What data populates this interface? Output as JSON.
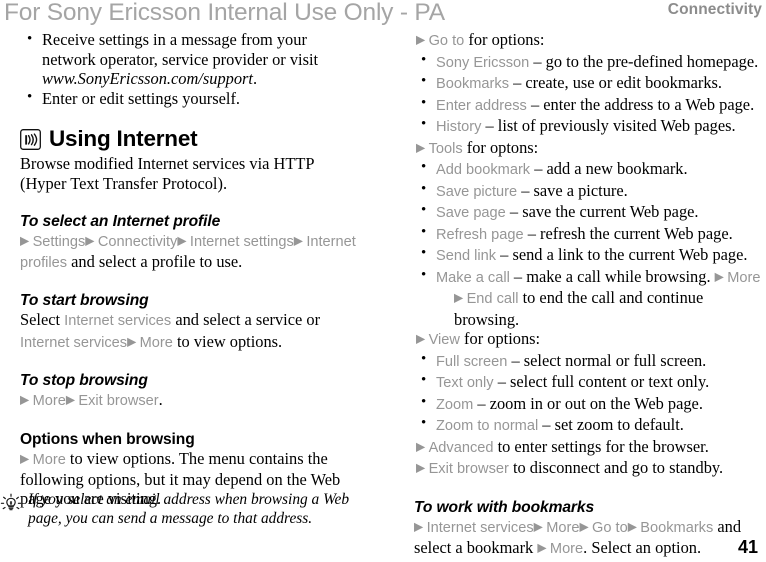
{
  "header": {
    "watermark": "For Sony Ericsson Internal Use Only - PA",
    "chapter": "Connectivity"
  },
  "page_number": "41",
  "left_column": {
    "intro_bullets": [
      {
        "line1": "Receive settings in a message from your",
        "line2": "network operator, service provider or visit",
        "line3_italic": "www.SonyEricsson.com/support",
        "line3_tail": "."
      },
      {
        "line1": "Enter or edit settings yourself."
      }
    ],
    "section": {
      "icon": "wifi-signal-icon",
      "title": "Using Internet",
      "description_line1": "Browse modified Internet services via HTTP",
      "description_line2": "(Hyper Text Transfer Protocol)."
    },
    "procedures": [
      {
        "heading": "To select an Internet profile",
        "heading_style": "italic",
        "parts": [
          {
            "t": "arrow"
          },
          {
            "t": "ui",
            "v": "Settings"
          },
          {
            "t": "arrow"
          },
          {
            "t": "ui",
            "v": "Connectivity"
          },
          {
            "t": "arrow"
          },
          {
            "t": "ui",
            "v": "Internet settings"
          },
          {
            "t": "arrow"
          },
          {
            "t": "ui",
            "v": "Internet profiles"
          },
          {
            "t": "text",
            "v": " and select a profile to use."
          }
        ]
      },
      {
        "heading": "To start browsing",
        "heading_style": "italic",
        "parts": [
          {
            "t": "text",
            "v": "Select "
          },
          {
            "t": "ui",
            "v": "Internet services"
          },
          {
            "t": "text",
            "v": " and select a service or "
          },
          {
            "t": "ui",
            "v": "Internet services"
          },
          {
            "t": "arrow"
          },
          {
            "t": "ui",
            "v": "More"
          },
          {
            "t": "text",
            "v": " to view options."
          }
        ]
      },
      {
        "heading": "To stop browsing",
        "heading_style": "italic",
        "parts": [
          {
            "t": "arrow"
          },
          {
            "t": "ui",
            "v": "More"
          },
          {
            "t": "arrow"
          },
          {
            "t": "ui",
            "v": "Exit browser"
          },
          {
            "t": "text",
            "v": "."
          }
        ]
      },
      {
        "heading": "Options when browsing",
        "heading_style": "upright",
        "parts": [
          {
            "t": "arrow"
          },
          {
            "t": "ui",
            "v": "More"
          },
          {
            "t": "text",
            "v": " to view options. The menu contains the following options, but it may depend on the Web page you are visiting."
          }
        ]
      }
    ],
    "tip": {
      "icon": "lightbulb-tip-icon",
      "text": "If you select an email address when browsing a Web page, you can send a message to that address."
    }
  },
  "right_column": {
    "blocks": [
      {
        "type": "arrow-line",
        "parts": [
          {
            "t": "arrow"
          },
          {
            "t": "ui",
            "v": "Go to"
          },
          {
            "t": "text",
            "v": " for options:"
          }
        ]
      },
      {
        "type": "bullets",
        "items": [
          [
            {
              "t": "ui",
              "v": "Sony Ericsson"
            },
            {
              "t": "text",
              "v": " – go to the pre-defined homepage."
            }
          ],
          [
            {
              "t": "ui",
              "v": "Bookmarks"
            },
            {
              "t": "text",
              "v": " – create, use or edit bookmarks."
            }
          ],
          [
            {
              "t": "ui",
              "v": "Enter address"
            },
            {
              "t": "text",
              "v": " – enter the address to a Web page."
            }
          ],
          [
            {
              "t": "ui",
              "v": "History"
            },
            {
              "t": "text",
              "v": " – list of previously visited Web pages."
            }
          ]
        ]
      },
      {
        "type": "arrow-line",
        "parts": [
          {
            "t": "arrow"
          },
          {
            "t": "ui",
            "v": "Tools"
          },
          {
            "t": "text",
            "v": " for optons:"
          }
        ]
      },
      {
        "type": "bullets",
        "items": [
          [
            {
              "t": "ui",
              "v": "Add bookmark"
            },
            {
              "t": "text",
              "v": " – add a new bookmark."
            }
          ],
          [
            {
              "t": "ui",
              "v": "Save picture"
            },
            {
              "t": "text",
              "v": " – save a picture."
            }
          ],
          [
            {
              "t": "ui",
              "v": "Save page"
            },
            {
              "t": "text",
              "v": " – save the current Web page."
            }
          ],
          [
            {
              "t": "ui",
              "v": "Refresh page"
            },
            {
              "t": "text",
              "v": " – refresh the current Web page."
            }
          ],
          [
            {
              "t": "ui",
              "v": "Send link"
            },
            {
              "t": "text",
              "v": " – send a link to the current Web page."
            }
          ],
          [
            {
              "t": "ui",
              "v": "Make a call"
            },
            {
              "t": "text",
              "v": " – make a call while browsing. "
            },
            {
              "t": "arrow"
            },
            {
              "t": "ui",
              "v": "More"
            },
            {
              "t": "break"
            },
            {
              "t": "arrow"
            },
            {
              "t": "ui",
              "v": "End call"
            },
            {
              "t": "text",
              "v": " to end the call and continue browsing."
            }
          ]
        ]
      },
      {
        "type": "arrow-line",
        "parts": [
          {
            "t": "arrow"
          },
          {
            "t": "ui",
            "v": "View"
          },
          {
            "t": "text",
            "v": " for options:"
          }
        ]
      },
      {
        "type": "bullets",
        "items": [
          [
            {
              "t": "ui",
              "v": "Full screen"
            },
            {
              "t": "text",
              "v": " – select normal or full screen."
            }
          ],
          [
            {
              "t": "ui",
              "v": "Text only"
            },
            {
              "t": "text",
              "v": " – select full content or text only."
            }
          ],
          [
            {
              "t": "ui",
              "v": "Zoom"
            },
            {
              "t": "text",
              "v": " – zoom in or out on the Web page."
            }
          ],
          [
            {
              "t": "ui",
              "v": "Zoom to normal"
            },
            {
              "t": "text",
              "v": " – set zoom to default."
            }
          ]
        ]
      },
      {
        "type": "arrow-line",
        "parts": [
          {
            "t": "arrow"
          },
          {
            "t": "ui",
            "v": "Advanced"
          },
          {
            "t": "text",
            "v": " to enter settings for the browser."
          }
        ]
      },
      {
        "type": "arrow-line",
        "parts": [
          {
            "t": "arrow"
          },
          {
            "t": "ui",
            "v": "Exit browser"
          },
          {
            "t": "text",
            "v": " to disconnect and go to standby."
          }
        ]
      },
      {
        "type": "spacer"
      },
      {
        "type": "procedure",
        "heading": "To work with bookmarks",
        "parts": [
          {
            "t": "arrow"
          },
          {
            "t": "ui",
            "v": "Internet services"
          },
          {
            "t": "arrow"
          },
          {
            "t": "ui",
            "v": "More"
          },
          {
            "t": "arrow"
          },
          {
            "t": "ui",
            "v": "Go to"
          },
          {
            "t": "arrow"
          },
          {
            "t": "ui",
            "v": "Bookmarks"
          },
          {
            "t": "text",
            "v": " and select a bookmark "
          },
          {
            "t": "arrow"
          },
          {
            "t": "ui",
            "v": "More"
          },
          {
            "t": "text",
            "v": ". Select an option."
          }
        ]
      }
    ]
  }
}
